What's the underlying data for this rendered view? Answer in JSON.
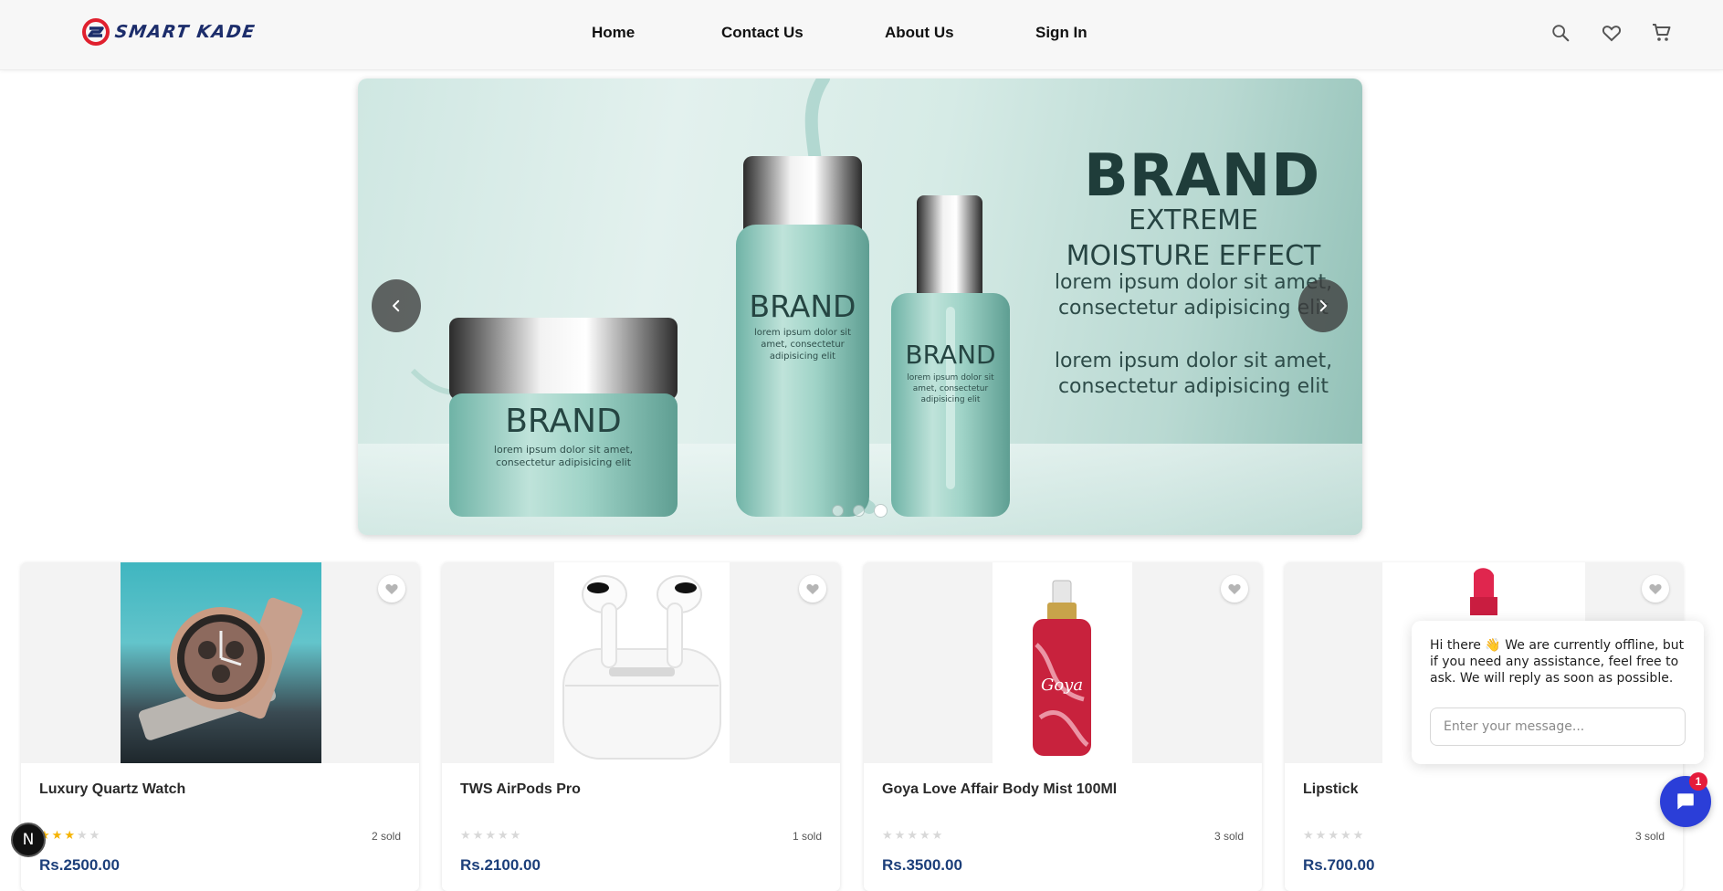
{
  "brand": {
    "name": "SMART KADE"
  },
  "nav": {
    "items": [
      "Home",
      "Contact Us",
      "About Us",
      "Sign In"
    ]
  },
  "header_icons": {
    "search": "search-icon",
    "wishlist": "heart-icon",
    "cart": "cart-icon"
  },
  "banner": {
    "heading": "BRAND",
    "subheading_line1": "EXTREME",
    "subheading_line2": "MOISTURE EFFECT",
    "body1": "lorem ipsum dolor sit amet, consectetur adipisicing elit",
    "body2": "lorem ipsum dolor sit amet, consectetur adipisicing elit",
    "product_label": "BRAND",
    "product_small_text": "lorem ipsum dolor sit amet, consectetur adipisicing elit",
    "slide_count": 3,
    "active_slide": 3
  },
  "products": [
    {
      "name": "Luxury Quartz Watch",
      "rating": 3,
      "max_rating": 5,
      "sold": "2 sold",
      "price": "Rs.2500.00"
    },
    {
      "name": "TWS AirPods Pro",
      "rating": 0,
      "max_rating": 5,
      "sold": "1 sold",
      "price": "Rs.2100.00"
    },
    {
      "name": "Goya Love Affair Body Mist 100Ml",
      "rating": 0,
      "max_rating": 5,
      "sold": "3 sold",
      "price": "Rs.3500.00"
    },
    {
      "name": "Lipstick",
      "rating": 0,
      "max_rating": 5,
      "sold": "3 sold",
      "price": "Rs.700.00"
    }
  ],
  "chat": {
    "greeting": "Hi there 👋 We are currently offline, but if you need any assistance, feel free to ask. We will reply as soon as possible.",
    "placeholder": "Enter your message...",
    "unread": "1"
  },
  "dev_badge": "N",
  "colors": {
    "brand_blue": "#1c2d6b",
    "brand_red": "#e0202e",
    "price": "#1c3f7a",
    "chat": "#2b3ed8",
    "star": "#f5b301"
  }
}
